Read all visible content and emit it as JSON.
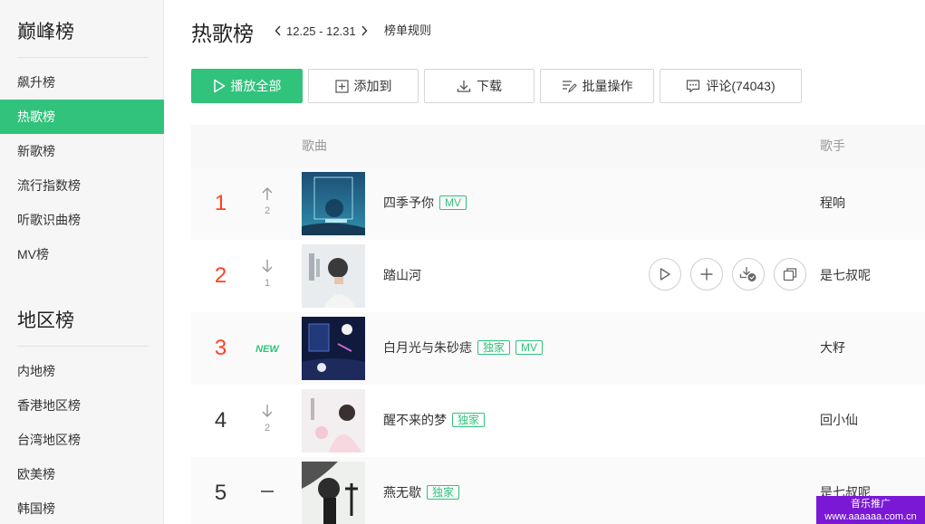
{
  "sidebar": {
    "section1_title": "巅峰榜",
    "section1_items": [
      {
        "label": "飙升榜"
      },
      {
        "label": "热歌榜"
      },
      {
        "label": "新歌榜"
      },
      {
        "label": "流行指数榜"
      },
      {
        "label": "听歌识曲榜"
      },
      {
        "label": "MV榜"
      }
    ],
    "section2_title": "地区榜",
    "section2_items": [
      {
        "label": "内地榜"
      },
      {
        "label": "香港地区榜"
      },
      {
        "label": "台湾地区榜"
      },
      {
        "label": "欧美榜"
      },
      {
        "label": "韩国榜"
      }
    ],
    "active_item": "热歌榜"
  },
  "header": {
    "title": "热歌榜",
    "date_range": "12.25 - 12.31",
    "rules_link": "榜单规则"
  },
  "toolbar": {
    "play_all": "播放全部",
    "add_to": "添加到",
    "download": "下载",
    "batch": "批量操作",
    "comments": "评论(74043)"
  },
  "table": {
    "col_song": "歌曲",
    "col_artist": "歌手",
    "rows": [
      {
        "rank": "1",
        "trend": "up",
        "change": "2",
        "title": "四季予你",
        "tags": [
          "MV"
        ],
        "artist": "程响"
      },
      {
        "rank": "2",
        "trend": "down",
        "change": "1",
        "title": "踏山河",
        "tags": [],
        "artist": "是七叔呢"
      },
      {
        "rank": "3",
        "trend": "new",
        "change": "NEW",
        "title": "白月光与朱砂痣",
        "tags": [
          "独家",
          "MV"
        ],
        "artist": "大籽"
      },
      {
        "rank": "4",
        "trend": "down",
        "change": "2",
        "title": "醒不来的梦",
        "tags": [
          "独家"
        ],
        "artist": "回小仙"
      },
      {
        "rank": "5",
        "trend": "same",
        "change": "",
        "title": "燕无歇",
        "tags": [
          "独家"
        ],
        "artist": "是七叔呢"
      }
    ]
  },
  "colors": {
    "accent": "#31c27c",
    "rank_top": "#ff4222",
    "watermark_bg": "#7a18d6"
  },
  "watermark": {
    "line1": "音乐推广",
    "line2": "www.aaaaaa.com.cn"
  }
}
